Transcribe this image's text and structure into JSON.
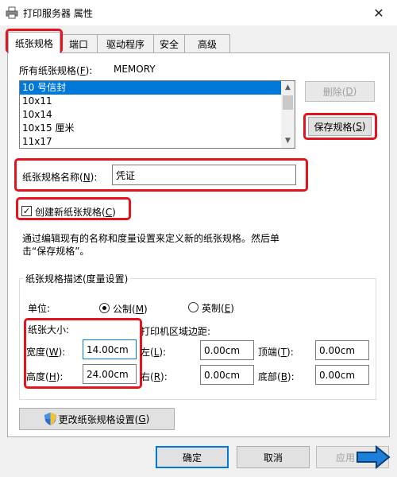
{
  "window": {
    "title": "打印服务器 属性",
    "close_glyph": "✕"
  },
  "tabs": [
    {
      "label": "纸张规格"
    },
    {
      "label": "端口"
    },
    {
      "label": "驱动程序"
    },
    {
      "label": "安全"
    },
    {
      "label": "高级"
    }
  ],
  "forms": {
    "all_label": "所有纸张规格(",
    "all_key": "F",
    "all_tail": "):",
    "server_name": "MEMORY",
    "list_items": [
      "10 号信封",
      "10x11",
      "10x14",
      "10x15 厘米",
      "11x17"
    ],
    "delete_label": "删除(",
    "delete_key": "D",
    "delete_tail": ")",
    "save_label": "保存规格(",
    "save_key": "S",
    "save_tail": ")",
    "name_label": "纸张规格名称(",
    "name_key": "N",
    "name_tail": "):",
    "name_value": "凭证",
    "create_check": "✓",
    "create_label": "创建新纸张规格(",
    "create_key": "C",
    "create_tail": ")",
    "desc_line1": "通过编辑现有的名称和度量设置来定义新的纸张规格。然后单",
    "desc_line2": "击“保存规格”。"
  },
  "measurements": {
    "group_title": "纸张规格描述(度量设置)",
    "unit_label": "单位:",
    "metric_label": "公制(",
    "metric_key": "M",
    "metric_tail": ")",
    "english_label": "英制(",
    "english_key": "E",
    "english_tail": ")",
    "paper_size_label": "纸张大小:",
    "margins_label": "打印机区域边距:",
    "width_label": "宽度(",
    "width_key": "W",
    "width_tail": "):",
    "width_value": "14.00cm",
    "height_label": "高度(",
    "height_key": "H",
    "height_tail": "):",
    "height_value": "24.00cm",
    "left_label": "左(",
    "left_key": "L",
    "left_tail": "):",
    "left_value": "0.00cm",
    "right_label": "右(",
    "right_key": "R",
    "right_tail": "):",
    "right_value": "0.00cm",
    "top_label": "顶端(",
    "top_key": "T",
    "top_tail": "):",
    "top_value": "0.00cm",
    "bottom_label": "底部(",
    "bottom_key": "B",
    "bottom_tail": "):",
    "bottom_value": "0.00cm"
  },
  "change_settings": {
    "label": "更改纸张规格设置(",
    "key": "G",
    "tail": ")"
  },
  "footer": {
    "ok": "确定",
    "cancel": "取消",
    "apply": "应用"
  },
  "colors": {
    "highlight_red": "#e4141e",
    "selection_blue": "#0078d7",
    "arrow_blue": "#1e7fd8"
  }
}
